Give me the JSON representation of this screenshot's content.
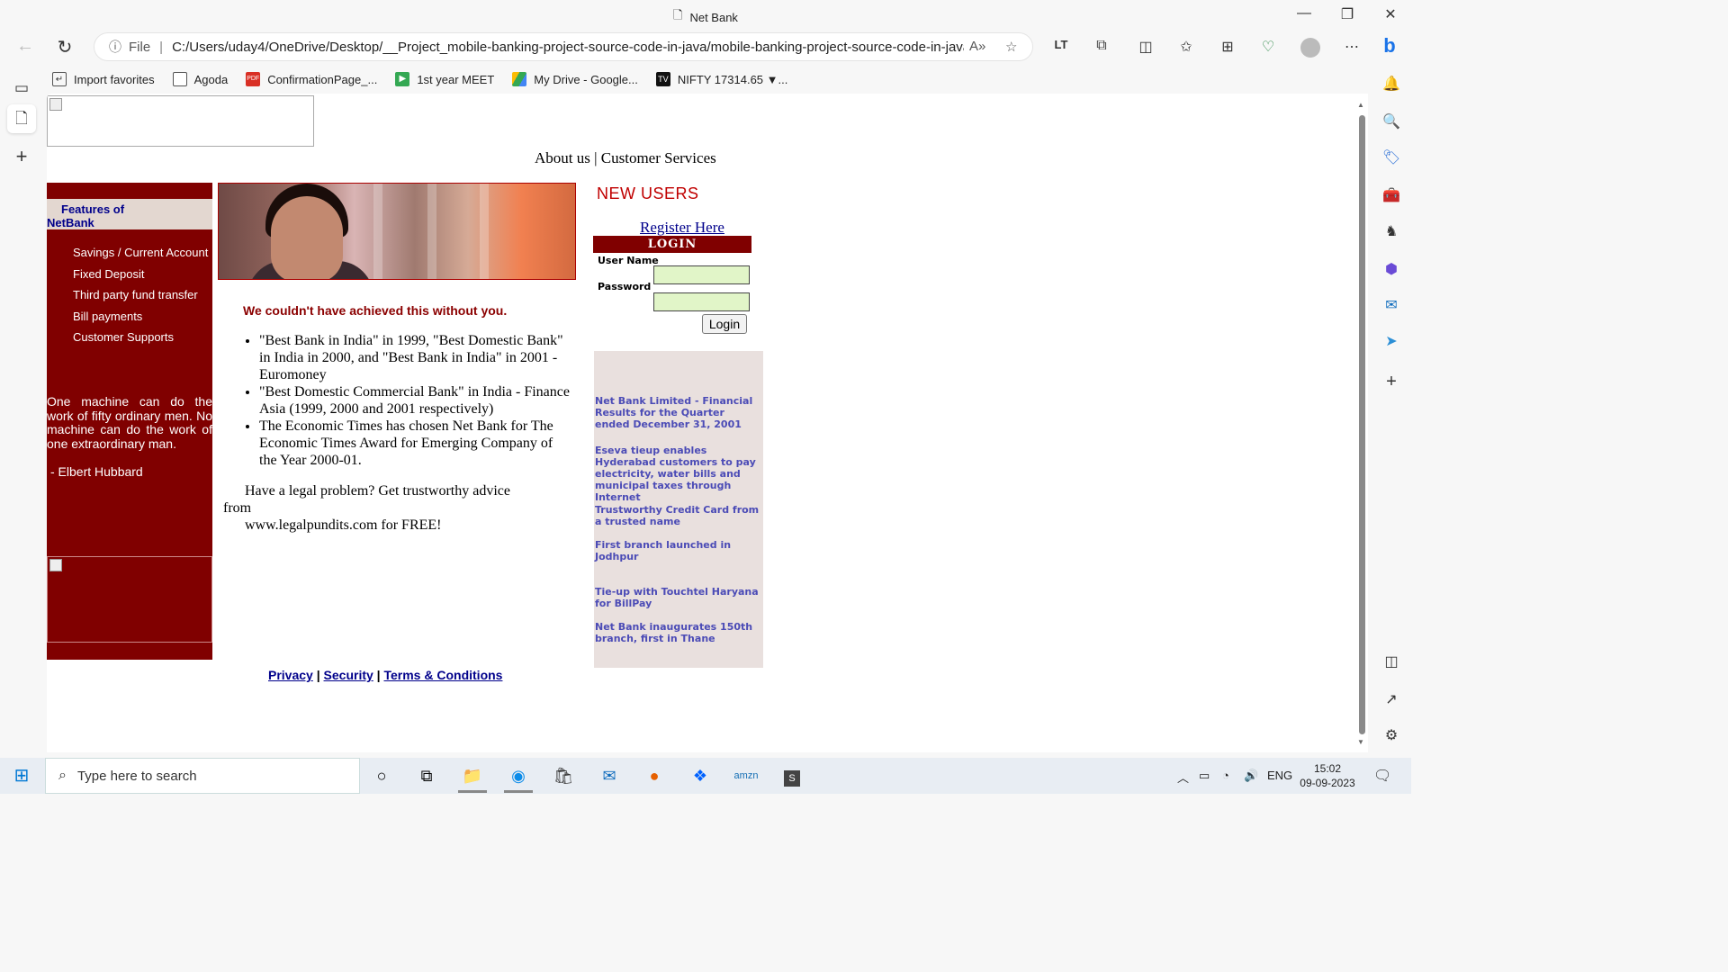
{
  "browser": {
    "tab_title": "Net Bank",
    "url_scheme": "File",
    "url": "C:/Users/uday4/OneDrive/Desktop/__Project_mobile-banking-project-source-code-in-java/mobile-banking-project-source-code-in-java/...",
    "favorites": [
      {
        "label": "Import favorites",
        "icon": "import-icon"
      },
      {
        "label": "Agoda",
        "icon": "page-icon"
      },
      {
        "label": "ConfirmationPage_...",
        "icon": "pdf-icon"
      },
      {
        "label": "1st year MEET",
        "icon": "meet-icon"
      },
      {
        "label": "My Drive - Google...",
        "icon": "drive-icon"
      },
      {
        "label": "NIFTY 17314.65 ▼...",
        "icon": "tradingview-icon"
      }
    ]
  },
  "page": {
    "top_links": {
      "about": "About us",
      "separator": "|",
      "services": "Customer Services"
    },
    "features": {
      "heading_line1": "Features  of",
      "heading_line2": "NetBank",
      "items": [
        "Savings / Current Account",
        "Fixed Deposit",
        "Third party fund transfer",
        "Bill payments",
        "Customer Supports"
      ]
    },
    "quote": {
      "text": "One machine can do the work of fifty ordinary men. No machine can do the work of one extraordinary man.",
      "author": "- Elbert Hubbard"
    },
    "tagline": "We couldn't have achieved this without you.",
    "awards": [
      "\"Best Bank in India\" in 1999, \"Best Domestic Bank\" in India in 2000, and \"Best Bank in India\" in 2001 - Euromoney",
      "\"Best Domestic Commercial Bank\" in India - Finance Asia (1999, 2000 and 2001 respectively)",
      "The Economic Times has chosen Net Bank for The Economic Times Award for Emerging Company of the Year 2000-01."
    ],
    "legal": {
      "line1": "Have a legal problem? Get trustworthy advice",
      "line2": "from",
      "line3": "www.legalpundits.com for FREE!"
    },
    "footer": {
      "privacy": "Privacy",
      "sep1": "|",
      "security": "Security",
      "sep2": "|",
      "terms": "Terms & Conditions"
    },
    "new_users": "NEW  USERS",
    "register": "Register Here",
    "login": {
      "heading": "LOGIN",
      "username_label": "User Name",
      "password_label": "Password",
      "username_value": "",
      "password_value": "",
      "button": "Login"
    },
    "news": [
      "Net Bank Limited - Financial Results for the Quarter ended December 31, 2001",
      "Eseva tieup enables Hyderabad customers  to pay electricity, water bills and municipal taxes through Internet",
      "Trustworthy Credit Card from a trusted name",
      "First branch launched in Jodhpur",
      "Tie-up with Touchtel Haryana for BillPay",
      "Net Bank inaugurates 150th branch, first in Thane"
    ]
  },
  "taskbar": {
    "search_placeholder": "Type here to search",
    "language": "ENG",
    "time": "15:02",
    "date": "09-09-2023"
  }
}
